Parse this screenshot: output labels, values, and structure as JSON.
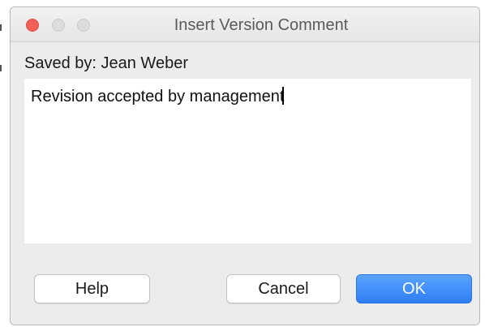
{
  "dialog": {
    "title": "Insert Version Comment",
    "saved_by": "Saved by: Jean Weber",
    "comment_text": "Revision accepted by management"
  },
  "buttons": {
    "help_label": "Help",
    "cancel_label": "Cancel",
    "ok_label": "OK"
  },
  "window_controls": {
    "close_color": "#f25f57",
    "inactive_color": "#dcdcdc"
  },
  "colors": {
    "accent": "#2f7ef5"
  }
}
